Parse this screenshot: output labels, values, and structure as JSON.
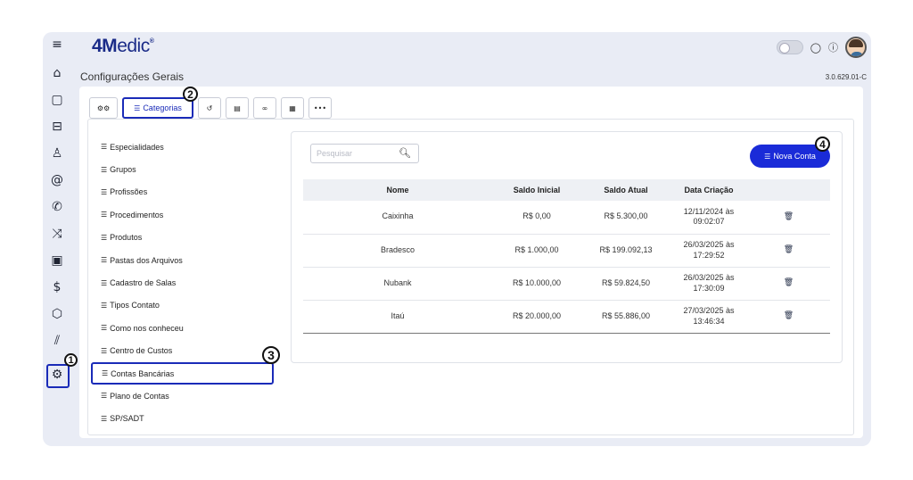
{
  "app": {
    "logo_bold": "4M",
    "logo_rest": "edic",
    "page_title": "Configurações Gerais",
    "version": "3.0.629.01-C"
  },
  "rail": {
    "items": [
      {
        "name": "menu-icon",
        "glyph": "≡"
      },
      {
        "name": "home-icon",
        "glyph": "⌂"
      },
      {
        "name": "calendar-icon",
        "glyph": "▢"
      },
      {
        "name": "sofa-icon",
        "glyph": "⊟"
      },
      {
        "name": "user-icon",
        "glyph": "♙"
      },
      {
        "name": "at-icon",
        "glyph": "@"
      },
      {
        "name": "phone-icon",
        "glyph": "✆"
      },
      {
        "name": "shuffle-icon",
        "glyph": "⤨"
      },
      {
        "name": "clipboard-icon",
        "glyph": "▣"
      },
      {
        "name": "dollar-icon",
        "glyph": "$"
      },
      {
        "name": "box-icon",
        "glyph": "⬡"
      },
      {
        "name": "chart-icon",
        "glyph": "⫽"
      },
      {
        "name": "settings-icon",
        "glyph": "⚙"
      }
    ]
  },
  "tabs": {
    "items": [
      {
        "name": "tab-general",
        "icon": "gears-icon",
        "glyph": "⚙⚙",
        "label": ""
      },
      {
        "name": "tab-categorias",
        "icon": "list-icon",
        "glyph": "☰",
        "label": "Categorias"
      },
      {
        "name": "tab-history",
        "icon": "history-icon",
        "glyph": "↺",
        "label": ""
      },
      {
        "name": "tab-card",
        "icon": "id-card-icon",
        "glyph": "▤",
        "label": ""
      },
      {
        "name": "tab-link",
        "icon": "link-icon",
        "glyph": "∞",
        "label": ""
      },
      {
        "name": "tab-calendar",
        "icon": "calendar-icon",
        "glyph": "▦",
        "label": ""
      },
      {
        "name": "tab-more",
        "icon": "more-icon",
        "glyph": "•••",
        "label": ""
      }
    ]
  },
  "categories": [
    "Especialidades",
    "Grupos",
    "Profissões",
    "Procedimentos",
    "Produtos",
    "Pastas dos Arquivos",
    "Cadastro de Salas",
    "Tipos Contato",
    "Como nos conheceu",
    "Centro de Custos",
    "Contas Bancárias",
    "Plano de Contas",
    "SP/SADT"
  ],
  "active_category": "Contas Bancárias",
  "search": {
    "placeholder": "Pesquisar"
  },
  "new_button": {
    "label": "Nova Conta"
  },
  "table": {
    "headers": [
      "Nome",
      "Saldo Inicial",
      "Saldo Atual",
      "Data Criação",
      ""
    ],
    "rows": [
      {
        "nome": "Caixinha",
        "inicial": "R$ 0,00",
        "atual": "R$ 5.300,00",
        "data1": "12/11/2024 às",
        "data2": "09:02:07"
      },
      {
        "nome": "Bradesco",
        "inicial": "R$ 1.000,00",
        "atual": "R$ 199.092,13",
        "data1": "26/03/2025 às",
        "data2": "17:29:52"
      },
      {
        "nome": "Nubank",
        "inicial": "R$ 10.000,00",
        "atual": "R$ 59.824,50",
        "data1": "26/03/2025 às",
        "data2": "17:30:09"
      },
      {
        "nome": "Itaú",
        "inicial": "R$ 20.000,00",
        "atual": "R$ 55.886,00",
        "data1": "27/03/2025 às",
        "data2": "13:46:34"
      }
    ]
  },
  "badges": [
    "1",
    "2",
    "3",
    "4"
  ],
  "colors": {
    "accent": "#1a2bd8",
    "highlight": "#1a2bb8",
    "frame": "#e9ecf5"
  }
}
